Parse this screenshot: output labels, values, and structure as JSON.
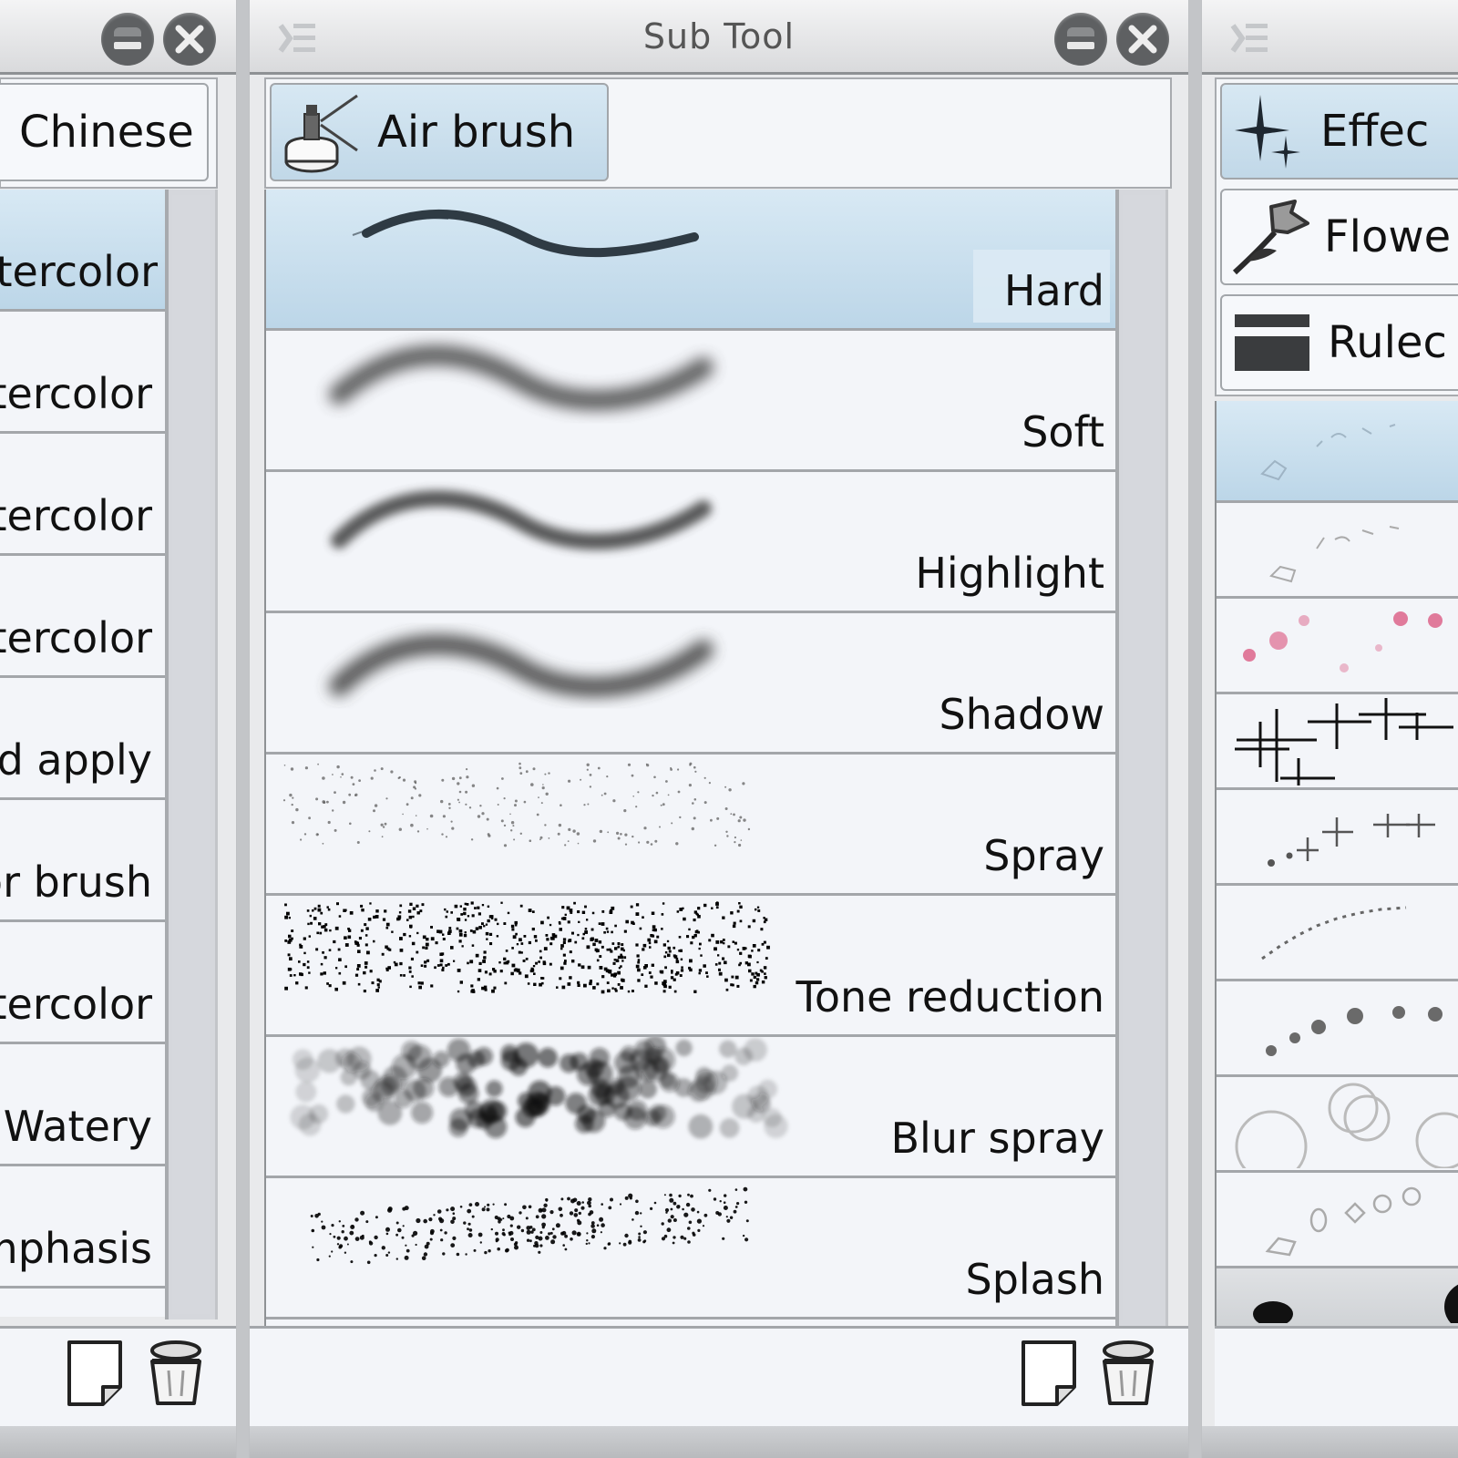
{
  "left_panel": {
    "group_tab": {
      "label": "Chinese",
      "active": false
    },
    "items": [
      {
        "label": "tercolor",
        "selected": true
      },
      {
        "label": "tercolor",
        "selected": false
      },
      {
        "label": "tercolor",
        "selected": false
      },
      {
        "label": "tercolor",
        "selected": false
      },
      {
        "label": "d apply",
        "selected": false
      },
      {
        "label": "or brush",
        "selected": false
      },
      {
        "label": "tercolor",
        "selected": false
      },
      {
        "label": "Watery",
        "selected": false
      },
      {
        "label": "mphasis",
        "selected": false
      }
    ],
    "footer": {
      "new_icon": "new-page-icon",
      "delete_icon": "trash-icon"
    }
  },
  "center_panel": {
    "title": "Sub Tool",
    "group_tab": {
      "label": "Air brush",
      "icon": "airbrush-icon",
      "active": true
    },
    "items": [
      {
        "label": "Hard",
        "preview": "hard-stroke",
        "selected": true
      },
      {
        "label": "Soft",
        "preview": "soft-stroke",
        "selected": false
      },
      {
        "label": "Highlight",
        "preview": "highlight-stroke",
        "selected": false
      },
      {
        "label": "Shadow",
        "preview": "shadow-stroke",
        "selected": false
      },
      {
        "label": "Spray",
        "preview": "spray-dots",
        "selected": false
      },
      {
        "label": "Tone reduction",
        "preview": "tone-dots",
        "selected": false
      },
      {
        "label": "Blur spray",
        "preview": "blur-dots",
        "selected": false
      },
      {
        "label": "Splash",
        "preview": "splash-dots",
        "selected": false
      }
    ],
    "footer": {
      "new_icon": "new-page-icon",
      "delete_icon": "trash-icon"
    }
  },
  "right_panel": {
    "group_tabs": [
      {
        "label": "Effec",
        "icon": "sparkle-icon",
        "active": true
      },
      {
        "label": "Flowe",
        "icon": "flower-icon",
        "active": false
      },
      {
        "label": "Rulec",
        "icon": "ruled-lines-icon",
        "active": false
      }
    ],
    "items": [
      {
        "preview": "doodle-selected",
        "selected": true
      },
      {
        "preview": "faint-doodles",
        "selected": false
      },
      {
        "preview": "pink-hearts",
        "selected": false
      },
      {
        "preview": "big-sparkles",
        "selected": false
      },
      {
        "preview": "small-sparkles",
        "selected": false
      },
      {
        "preview": "cross-stitch",
        "selected": false
      },
      {
        "preview": "grey-dots",
        "selected": false
      },
      {
        "preview": "bubbles",
        "selected": false
      },
      {
        "preview": "outline-doodles",
        "selected": false
      },
      {
        "preview": "black-blobs",
        "selected": false
      }
    ]
  }
}
